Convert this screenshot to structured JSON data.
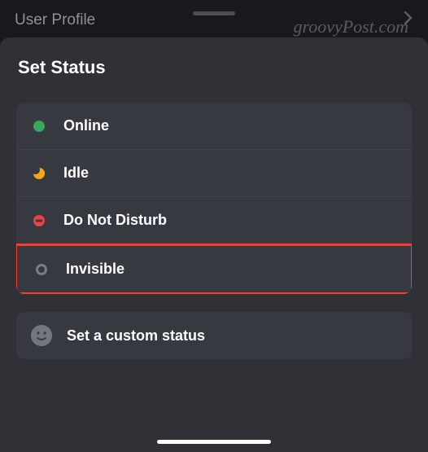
{
  "header": {
    "title": "User Profile"
  },
  "watermark": "groovyPost.com",
  "sheet": {
    "title": "Set Status"
  },
  "status_options": [
    {
      "label": "Online",
      "icon": "online-dot"
    },
    {
      "label": "Idle",
      "icon": "idle-moon"
    },
    {
      "label": "Do Not Disturb",
      "icon": "dnd-dash"
    },
    {
      "label": "Invisible",
      "icon": "invisible-ring",
      "highlighted": true
    }
  ],
  "custom_status": {
    "label": "Set a custom status"
  }
}
